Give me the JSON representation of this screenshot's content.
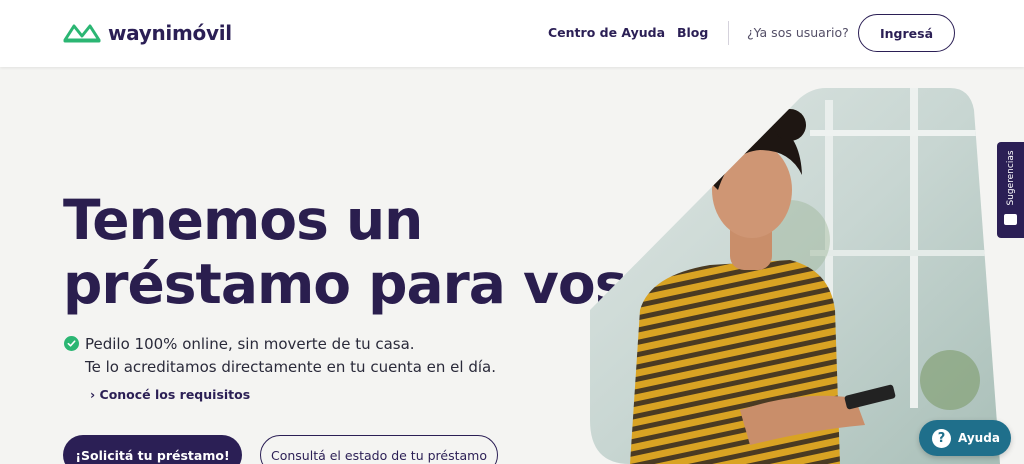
{
  "header": {
    "brand": "waynimóvil",
    "nav": {
      "help_center": "Centro de Ayuda",
      "blog": "Blog",
      "user_question": "¿Ya sos usuario?",
      "login": "Ingresá"
    }
  },
  "hero": {
    "headline_line1": "Tenemos un",
    "headline_line2": "préstamo para vos",
    "feature_line1": "Pedilo 100% online, sin moverte de tu casa.",
    "feature_line2": "Te lo acreditamos directamente en tu cuenta en el día.",
    "requirements_link": "Conocé los requisitos",
    "cta_primary": "¡Solicitá tu préstamo!",
    "cta_secondary": "Consultá el estado de tu préstamo"
  },
  "widgets": {
    "feedback_tab": "Sugerencias",
    "help_button": "Ayuda",
    "help_icon_glyph": "?"
  },
  "colors": {
    "brand_dark": "#2b1f55",
    "brand_green": "#2bb673",
    "help_teal": "#1f6f8b",
    "background": "#f4f4f2"
  }
}
